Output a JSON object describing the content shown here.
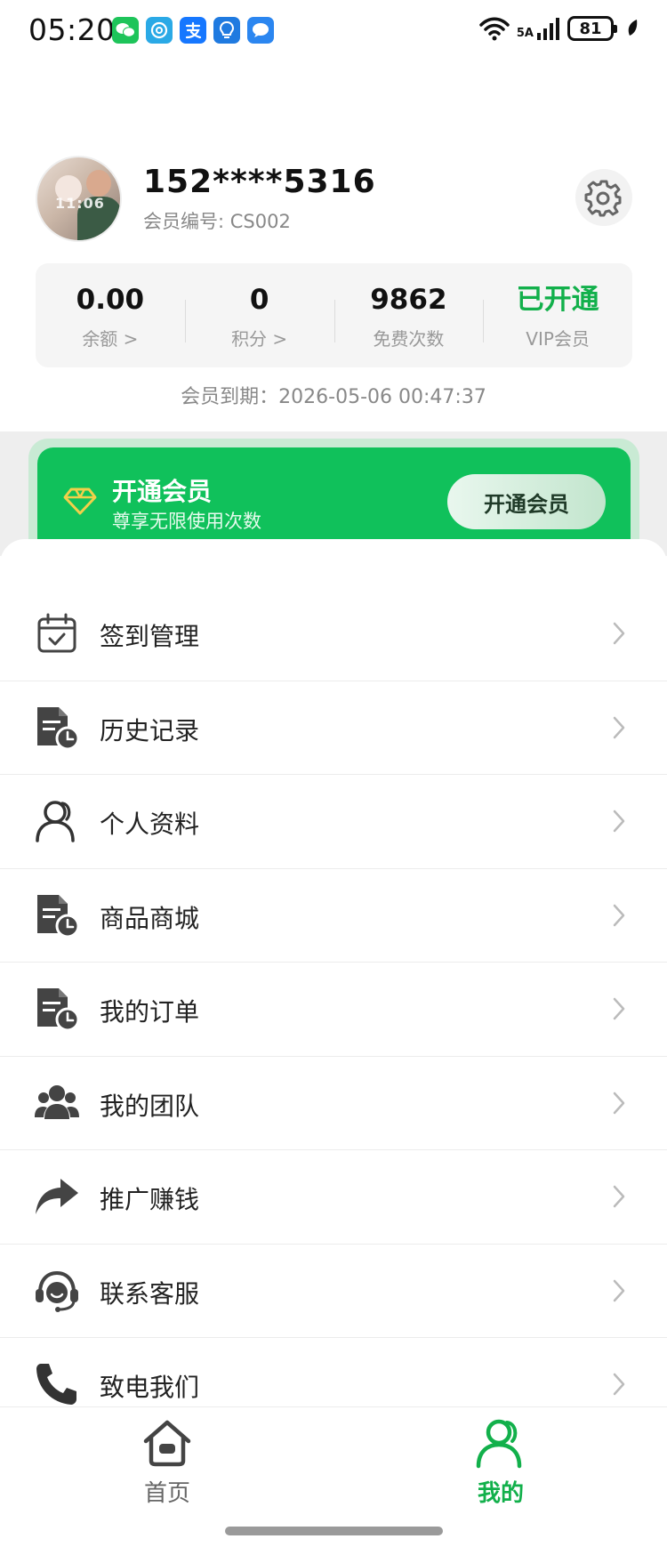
{
  "status_bar": {
    "time": "05:20",
    "apps": [
      {
        "icon": "wechat-icon",
        "color": "#1ec45a",
        "glyph": "✆"
      },
      {
        "icon": "browser-icon",
        "color": "#2aa9e6",
        "glyph": "◎"
      },
      {
        "icon": "alipay-icon",
        "color": "#1677ff",
        "glyph": "支"
      },
      {
        "icon": "bulb-icon",
        "color": "#1f7ae0",
        "glyph": "☼"
      },
      {
        "icon": "message-icon",
        "color": "#2b86f0",
        "glyph": "●"
      }
    ],
    "network_label": "5A",
    "battery": "81"
  },
  "profile": {
    "phone": "152****5316",
    "member_id": "会员编号: CS002",
    "avatar_clock": "11:06"
  },
  "stats": [
    {
      "value": "0.00",
      "label": "余额 >"
    },
    {
      "value": "0",
      "label": "积分 >"
    },
    {
      "value": "9862",
      "label": "免费次数"
    },
    {
      "value": "已开通",
      "label": "VIP会员"
    }
  ],
  "expiry": "会员到期：2026-05-06 00:47:37",
  "vip": {
    "title": "开通会员",
    "subtitle": "尊享无限使用次数",
    "button": "开通会员"
  },
  "menu": [
    {
      "label": "签到管理",
      "icon": "calendar-check-icon"
    },
    {
      "label": "历史记录",
      "icon": "document-clock-icon"
    },
    {
      "label": "个人资料",
      "icon": "user-icon"
    },
    {
      "label": "商品商城",
      "icon": "document-clock-icon"
    },
    {
      "label": "我的订单",
      "icon": "document-clock-icon"
    },
    {
      "label": "我的团队",
      "icon": "team-icon"
    },
    {
      "label": "推广赚钱",
      "icon": "share-arrow-icon"
    },
    {
      "label": "联系客服",
      "icon": "headset-icon"
    },
    {
      "label": "致电我们",
      "icon": "phone-icon"
    }
  ],
  "tabs": [
    {
      "label": "首页",
      "icon": "home-icon",
      "active": false
    },
    {
      "label": "我的",
      "icon": "user-icon",
      "active": true
    }
  ],
  "colors": {
    "accent": "#12b04b",
    "vip_banner": "#10c15b"
  }
}
